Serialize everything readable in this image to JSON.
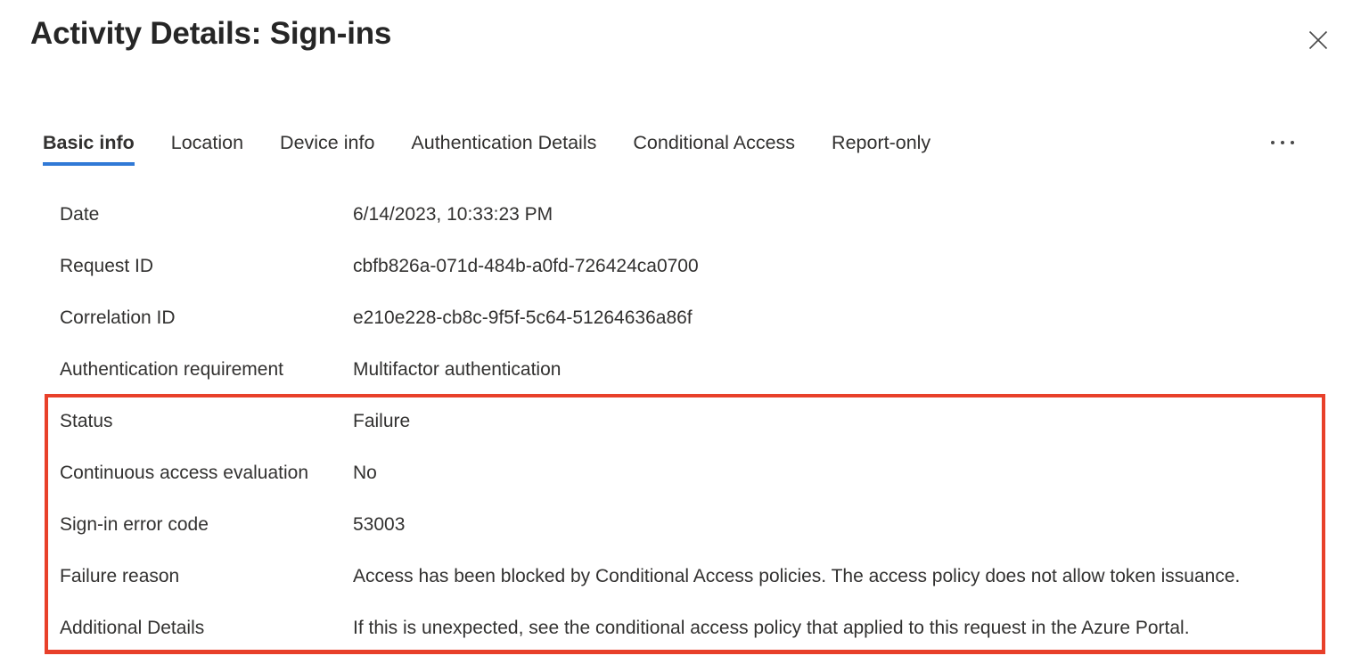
{
  "header": {
    "title": "Activity Details: Sign-ins",
    "close_label": "Close",
    "close_icon": "close-icon"
  },
  "tabs": {
    "items": [
      {
        "label": "Basic info",
        "active": true
      },
      {
        "label": "Location",
        "active": false
      },
      {
        "label": "Device info",
        "active": false
      },
      {
        "label": "Authentication Details",
        "active": false
      },
      {
        "label": "Conditional Access",
        "active": false
      },
      {
        "label": "Report-only",
        "active": false
      }
    ],
    "overflow_label": "More tabs",
    "overflow_icon": "ellipsis-icon",
    "active_indicator_color": "#3079d6"
  },
  "details": {
    "rows": [
      {
        "label": "Date",
        "value": "6/14/2023, 10:33:23 PM"
      },
      {
        "label": "Request ID",
        "value": "cbfb826a-071d-484b-a0fd-726424ca0700"
      },
      {
        "label": "Correlation ID",
        "value": "e210e228-cb8c-9f5f-5c64-51264636a86f"
      },
      {
        "label": "Authentication requirement",
        "value": "Multifactor authentication"
      },
      {
        "label": "Status",
        "value": "Failure"
      },
      {
        "label": "Continuous access evaluation",
        "value": "No"
      },
      {
        "label": "Sign-in error code",
        "value": "53003"
      },
      {
        "label": "Failure reason",
        "value": "Access has been blocked by Conditional Access policies. The access policy does not allow token issuance."
      },
      {
        "label": "Additional Details",
        "value": "If this is unexpected, see the conditional access policy that applied to this request in the Azure Portal."
      }
    ]
  },
  "highlight": {
    "color": "#e8402a",
    "first_row_index": 4,
    "last_row_index": 8
  }
}
